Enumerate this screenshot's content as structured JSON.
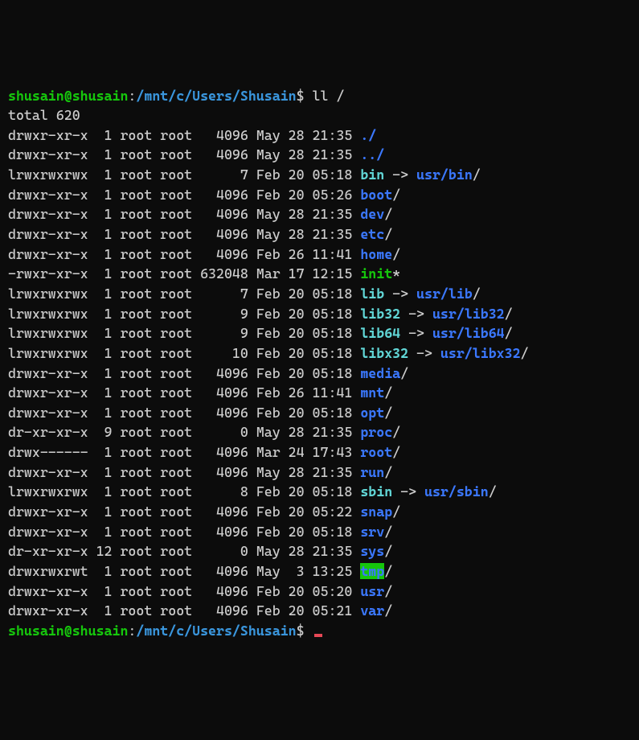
{
  "prompt": {
    "user": "shusain@shusain",
    "colon": ":",
    "path": "/mnt/c/Users/Shusain",
    "dollar": "$"
  },
  "command1": "ll /",
  "command2": "",
  "total_line": "total 620",
  "rows": [
    {
      "perm": "drwxr-xr-x",
      "links": "1",
      "owner": "root",
      "group": "root",
      "size": "4096",
      "date": "May 28 21:35",
      "name": "./",
      "cls": "dir"
    },
    {
      "perm": "drwxr-xr-x",
      "links": "1",
      "owner": "root",
      "group": "root",
      "size": "4096",
      "date": "May 28 21:35",
      "name": "../",
      "cls": "dir"
    },
    {
      "perm": "lrwxrwxrwx",
      "links": "1",
      "owner": "root",
      "group": "root",
      "size": "7",
      "date": "Feb 20 05:18",
      "name": "bin",
      "cls": "link",
      "arrow": " -> ",
      "target": "usr/bin",
      "tslash": "/"
    },
    {
      "perm": "drwxr-xr-x",
      "links": "1",
      "owner": "root",
      "group": "root",
      "size": "4096",
      "date": "Feb 20 05:26",
      "name": "boot",
      "cls": "dir",
      "slash": "/"
    },
    {
      "perm": "drwxr-xr-x",
      "links": "1",
      "owner": "root",
      "group": "root",
      "size": "4096",
      "date": "May 28 21:35",
      "name": "dev",
      "cls": "dir",
      "slash": "/"
    },
    {
      "perm": "drwxr-xr-x",
      "links": "1",
      "owner": "root",
      "group": "root",
      "size": "4096",
      "date": "May 28 21:35",
      "name": "etc",
      "cls": "dir",
      "slash": "/"
    },
    {
      "perm": "drwxr-xr-x",
      "links": "1",
      "owner": "root",
      "group": "root",
      "size": "4096",
      "date": "Feb 26 11:41",
      "name": "home",
      "cls": "dir",
      "slash": "/"
    },
    {
      "perm": "-rwxr-xr-x",
      "links": "1",
      "owner": "root",
      "group": "root",
      "size": "632048",
      "date": "Mar 17 12:15",
      "name": "init",
      "cls": "exec",
      "star": "*"
    },
    {
      "perm": "lrwxrwxrwx",
      "links": "1",
      "owner": "root",
      "group": "root",
      "size": "7",
      "date": "Feb 20 05:18",
      "name": "lib",
      "cls": "link",
      "arrow": " -> ",
      "target": "usr/lib",
      "tslash": "/"
    },
    {
      "perm": "lrwxrwxrwx",
      "links": "1",
      "owner": "root",
      "group": "root",
      "size": "9",
      "date": "Feb 20 05:18",
      "name": "lib32",
      "cls": "link",
      "arrow": " -> ",
      "target": "usr/lib32",
      "tslash": "/"
    },
    {
      "perm": "lrwxrwxrwx",
      "links": "1",
      "owner": "root",
      "group": "root",
      "size": "9",
      "date": "Feb 20 05:18",
      "name": "lib64",
      "cls": "link",
      "arrow": " -> ",
      "target": "usr/lib64",
      "tslash": "/"
    },
    {
      "perm": "lrwxrwxrwx",
      "links": "1",
      "owner": "root",
      "group": "root",
      "size": "10",
      "date": "Feb 20 05:18",
      "name": "libx32",
      "cls": "link",
      "arrow": " -> ",
      "target": "usr/libx32",
      "tslash": "/"
    },
    {
      "perm": "drwxr-xr-x",
      "links": "1",
      "owner": "root",
      "group": "root",
      "size": "4096",
      "date": "Feb 20 05:18",
      "name": "media",
      "cls": "dir",
      "slash": "/"
    },
    {
      "perm": "drwxr-xr-x",
      "links": "1",
      "owner": "root",
      "group": "root",
      "size": "4096",
      "date": "Feb 26 11:41",
      "name": "mnt",
      "cls": "dir",
      "slash": "/"
    },
    {
      "perm": "drwxr-xr-x",
      "links": "1",
      "owner": "root",
      "group": "root",
      "size": "4096",
      "date": "Feb 20 05:18",
      "name": "opt",
      "cls": "dir",
      "slash": "/"
    },
    {
      "perm": "dr-xr-xr-x",
      "links": "9",
      "owner": "root",
      "group": "root",
      "size": "0",
      "date": "May 28 21:35",
      "name": "proc",
      "cls": "dir",
      "slash": "/"
    },
    {
      "perm": "drwx------",
      "links": "1",
      "owner": "root",
      "group": "root",
      "size": "4096",
      "date": "Mar 24 17:43",
      "name": "root",
      "cls": "dir",
      "slash": "/"
    },
    {
      "perm": "drwxr-xr-x",
      "links": "1",
      "owner": "root",
      "group": "root",
      "size": "4096",
      "date": "May 28 21:35",
      "name": "run",
      "cls": "dir",
      "slash": "/"
    },
    {
      "perm": "lrwxrwxrwx",
      "links": "1",
      "owner": "root",
      "group": "root",
      "size": "8",
      "date": "Feb 20 05:18",
      "name": "sbin",
      "cls": "link",
      "arrow": " -> ",
      "target": "usr/sbin",
      "tslash": "/"
    },
    {
      "perm": "drwxr-xr-x",
      "links": "1",
      "owner": "root",
      "group": "root",
      "size": "4096",
      "date": "Feb 20 05:22",
      "name": "snap",
      "cls": "dir",
      "slash": "/"
    },
    {
      "perm": "drwxr-xr-x",
      "links": "1",
      "owner": "root",
      "group": "root",
      "size": "4096",
      "date": "Feb 20 05:18",
      "name": "srv",
      "cls": "dir",
      "slash": "/"
    },
    {
      "perm": "dr-xr-xr-x",
      "links": "12",
      "owner": "root",
      "group": "root",
      "size": "0",
      "date": "May 28 21:35",
      "name": "sys",
      "cls": "dir",
      "slash": "/"
    },
    {
      "perm": "drwxrwxrwt",
      "links": "1",
      "owner": "root",
      "group": "root",
      "size": "4096",
      "date": "May  3 13:25",
      "name": "tmp",
      "cls": "tmp",
      "slash": "/"
    },
    {
      "perm": "drwxr-xr-x",
      "links": "1",
      "owner": "root",
      "group": "root",
      "size": "4096",
      "date": "Feb 20 05:20",
      "name": "usr",
      "cls": "dir",
      "slash": "/"
    },
    {
      "perm": "drwxr-xr-x",
      "links": "1",
      "owner": "root",
      "group": "root",
      "size": "4096",
      "date": "Feb 20 05:21",
      "name": "var",
      "cls": "dir",
      "slash": "/"
    }
  ]
}
